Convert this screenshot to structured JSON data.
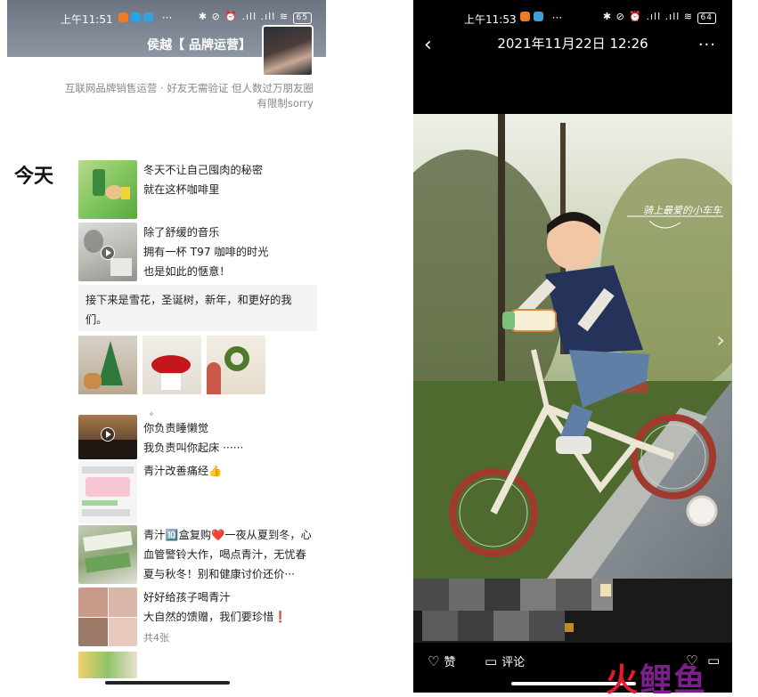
{
  "left": {
    "status_time": "上午11:51",
    "status_more": "···",
    "status_right": "✱ ⊘ ⏰ .ıll .ıll ≋",
    "battery": "65",
    "nickname": "侯越【 品牌运营】",
    "signature": "互联网品牌销售运营 · 好友无需验证 但人数过万朋友圈有限制sorry",
    "day_label": "今天",
    "posts": [
      {
        "text": "冬天不让自己囤肉的秘密\n就在这杯咖啡里"
      },
      {
        "text": "除了舒缓的音乐\n拥有一杯 T97 咖啡的时光\n也是如此的惬意！"
      },
      {
        "text": "你负责睡懒觉\n我负责叫你起床 ······"
      },
      {
        "text": "青汁改善痛经👍"
      },
      {
        "text": "青汁🔟盒复购❤️一夜从夏到冬，心\n血管警铃大作，喝点青汁，无忧春\n夏与秋冬！别和健康讨价还价···"
      },
      {
        "text": "好好给孩子喝青汁\n大自然的馈赠，我们要珍惜❗"
      }
    ],
    "share_text": "接下来是雪花，圣诞树，新年，和更好的我们。",
    "dot_text": "。",
    "photo_count": "共4张"
  },
  "right": {
    "status_time": "上午11:53",
    "status_more": "···",
    "status_right": "✱ ⊘ ⏰ .ıll .ıll ≋",
    "battery": "64",
    "title": "2021年11月22日 12:26",
    "more": "···",
    "photo_caption": "骑上最爱的小车车",
    "like_label": "赞",
    "comment_label": "评论"
  },
  "watermark": {
    "part1": "火",
    "part2": "鲤鱼"
  },
  "icons": {
    "back": "back-chevron-icon",
    "like": "heart-icon",
    "comment": "comment-icon",
    "play": "play-icon"
  }
}
